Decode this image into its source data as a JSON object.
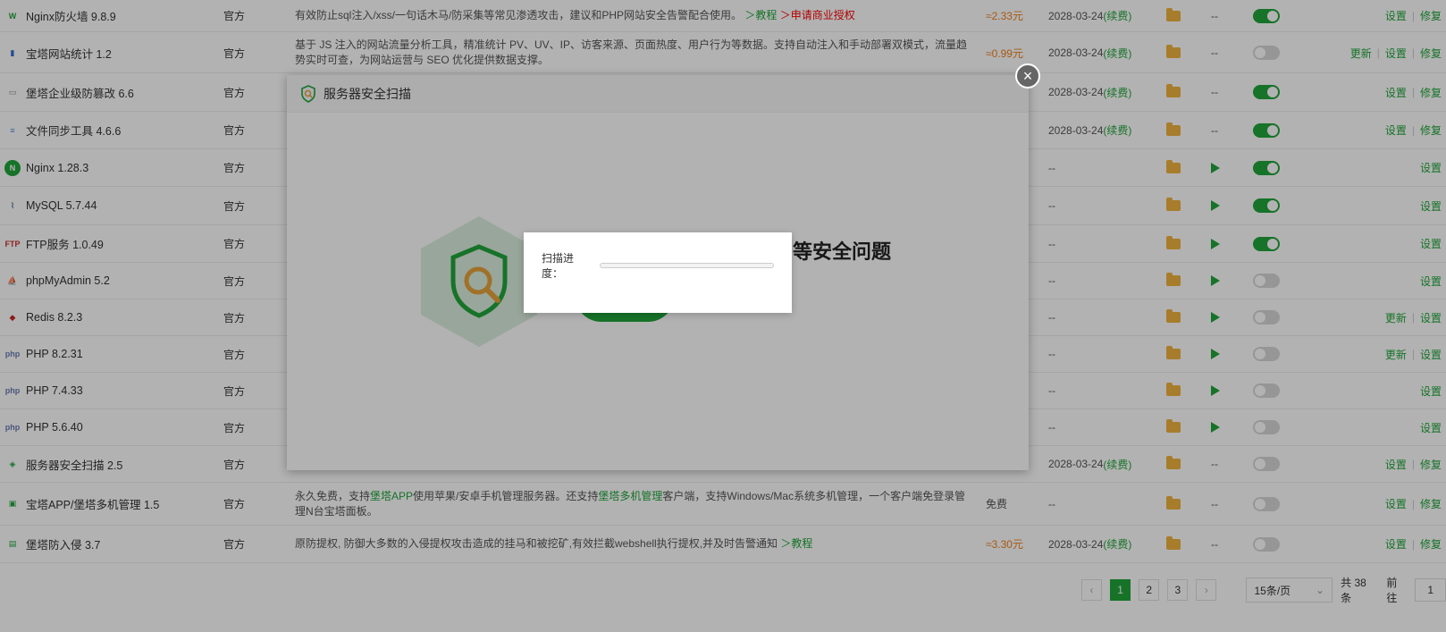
{
  "colors": {
    "accent": "#20a53a",
    "price": "#f0801c",
    "link_red": "#ff0000",
    "overlay": "rgba(0,0,0,0.3)"
  },
  "rows": [
    {
      "name": "Nginx防火墙 9.8.9",
      "icon": "firewall-icon",
      "dev": "官方",
      "desc_parts": [
        {
          "t": "有效防止sql注入/xss/一句话木马/防采集等常见渗透攻击，建议和PHP网站安全告警配合使用。 "
        },
        {
          "t": "＞教程",
          "c": "blue"
        },
        {
          "t": " "
        },
        {
          "t": "＞申请商业授权",
          "c": "red"
        }
      ],
      "price": "≈2.33元",
      "expire": "2028-03-24",
      "renew": "(续费)",
      "display": "--",
      "on": true,
      "actions": [
        "设置",
        "修复"
      ]
    },
    {
      "name": "宝塔网站统计 1.2",
      "icon": "bar-stats-icon",
      "dev": "官方",
      "desc_parts": [
        {
          "t": "基于 JS 注入的网站流量分析工具，精准统计 PV、UV、IP、访客来源、页面热度、用户行为等数据。支持自动注入和手动部署双模式，流量趋势实时可查，为网站运营与 SEO 优化提供数据支撑。"
        }
      ],
      "price": "≈0.99元",
      "expire": "2028-03-24",
      "renew": "(续费)",
      "display": "--",
      "on": false,
      "actions": [
        "更新",
        "设置",
        "修复"
      ]
    },
    {
      "name": "堡塔企业级防篡改 6.6",
      "icon": "tamper-icon",
      "dev": "官方",
      "desc_parts": [],
      "price": "",
      "expire": "2028-03-24",
      "renew": "(续费)",
      "display": "--",
      "on": true,
      "actions": [
        "设置",
        "修复"
      ]
    },
    {
      "name": "文件同步工具 4.6.6",
      "icon": "file-sync-icon",
      "dev": "官方",
      "desc_parts": [],
      "price": "",
      "expire": "2028-03-24",
      "renew": "(续费)",
      "display": "--",
      "on": true,
      "actions": [
        "设置",
        "修复"
      ]
    },
    {
      "name": "Nginx 1.28.3",
      "icon": "nginx-icon",
      "dev": "官方",
      "desc_parts": [],
      "price": "",
      "expire": "--",
      "renew": "",
      "display": "play",
      "on": true,
      "actions": [
        "设置"
      ]
    },
    {
      "name": "MySQL 5.7.44",
      "icon": "mysql-icon",
      "dev": "官方",
      "desc_parts": [],
      "price": "",
      "expire": "--",
      "renew": "",
      "display": "play",
      "on": true,
      "actions": [
        "设置"
      ]
    },
    {
      "name": "FTP服务 1.0.49",
      "icon": "ftp-icon",
      "dev": "官方",
      "desc_parts": [],
      "price": "",
      "expire": "--",
      "renew": "",
      "display": "play",
      "on": true,
      "actions": [
        "设置"
      ]
    },
    {
      "name": "phpMyAdmin 5.2",
      "icon": "phpmyadmin-icon",
      "dev": "官方",
      "desc_parts": [],
      "price": "",
      "expire": "--",
      "renew": "",
      "display": "play",
      "on": false,
      "actions": [
        "设置"
      ]
    },
    {
      "name": "Redis 8.2.3",
      "icon": "redis-icon",
      "dev": "官方",
      "desc_parts": [],
      "price": "",
      "expire": "--",
      "renew": "",
      "display": "play",
      "on": false,
      "actions": [
        "更新",
        "设置"
      ]
    },
    {
      "name": "PHP 8.2.31",
      "icon": "php-icon",
      "dev": "官方",
      "desc_parts": [],
      "price": "",
      "expire": "--",
      "renew": "",
      "display": "play",
      "on": false,
      "actions": [
        "更新",
        "设置"
      ]
    },
    {
      "name": "PHP 7.4.33",
      "icon": "php-icon",
      "dev": "官方",
      "desc_parts": [],
      "price": "",
      "expire": "--",
      "renew": "",
      "display": "play",
      "on": false,
      "actions": [
        "设置"
      ]
    },
    {
      "name": "PHP 5.6.40",
      "icon": "php-icon",
      "dev": "官方",
      "desc_parts": [],
      "price": "",
      "expire": "--",
      "renew": "",
      "display": "play",
      "on": false,
      "actions": [
        "设置"
      ]
    },
    {
      "name": "服务器安全扫描 2.5",
      "icon": "security-scan-icon",
      "dev": "官方",
      "desc_parts": [],
      "price": "",
      "expire": "2028-03-24",
      "renew": "(续费)",
      "display": "--",
      "on": false,
      "actions": [
        "设置",
        "修复"
      ]
    },
    {
      "name": "宝塔APP/堡塔多机管理 1.5",
      "icon": "app-icon",
      "dev": "官方",
      "desc_parts": [
        {
          "t": "永久免费，支持"
        },
        {
          "t": "堡塔APP",
          "c": "blue"
        },
        {
          "t": "使用苹果/安卓手机管理服务器。还支持"
        },
        {
          "t": "堡塔多机管理",
          "c": "blue"
        },
        {
          "t": "客户端，支持Windows/Mac系统多机管理，一个客户端免登录管理N台宝塔面板。"
        }
      ],
      "price": "免费",
      "price_plain": true,
      "expire": "--",
      "renew": "",
      "display": "--",
      "on": false,
      "actions": [
        "设置",
        "修复"
      ]
    },
    {
      "name": "堡塔防入侵 3.7",
      "icon": "intrusion-icon",
      "dev": "官方",
      "desc_parts": [
        {
          "t": "原防提权, 防御大多数的入侵提权攻击造成的挂马和被挖矿,有效拦截webshell执行提权,并及时告警通知 "
        },
        {
          "t": "＞教程",
          "c": "blue"
        }
      ],
      "price": "≈3.30元",
      "expire": "2028-03-24",
      "renew": "(续费)",
      "display": "--",
      "on": false,
      "actions": [
        "设置",
        "修复"
      ]
    }
  ],
  "pager": {
    "prev": "‹",
    "pages": [
      "1",
      "2",
      "3"
    ],
    "next": "›",
    "page_size": "15条/页",
    "total": "共 38 条",
    "goto_label": "前往",
    "goto_value": "1"
  },
  "dialog": {
    "title": "服务器安全扫描",
    "headline": "等安全问题",
    "close": "×"
  },
  "progress": {
    "label": "扫描进度：",
    "value": 0
  }
}
